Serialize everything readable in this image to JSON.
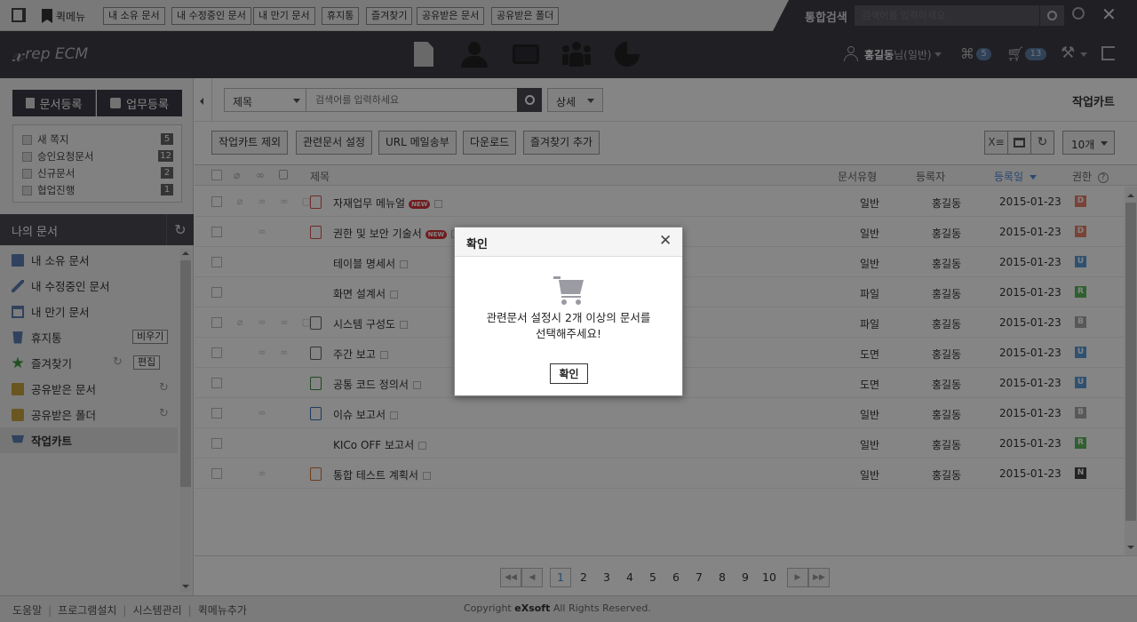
{
  "topbar": {
    "quickmenu_label": "퀵메뉴",
    "quick_links": [
      "내 소유 문서",
      "내 수정중인 문서",
      "내 만기 문서",
      "휴지통",
      "즐겨찾기",
      "공유받은 문서",
      "공유받은 폴더"
    ],
    "search_label": "통합검색",
    "search_placeholder": "검색어를 입력하세요"
  },
  "header": {
    "logo_text": "rep ECM",
    "user_name": "홍길동",
    "user_suffix": "님(일반)",
    "approval_count": "5",
    "cart_count": "13"
  },
  "sidebar": {
    "register_doc": "문서등록",
    "register_task": "업무등록",
    "notices": [
      {
        "label": "새 쪽지",
        "count": "5"
      },
      {
        "label": "승인요청문서",
        "count": "12"
      },
      {
        "label": "신규문서",
        "count": "2"
      },
      {
        "label": "협업진행",
        "count": "1"
      }
    ],
    "mydocs_title": "나의 문서",
    "items": [
      {
        "label": "내 소유 문서",
        "icon": "book-icon"
      },
      {
        "label": "내 수정중인 문서",
        "icon": "pencil-icon"
      },
      {
        "label": "내 만기 문서",
        "icon": "calendar-icon"
      },
      {
        "label": "휴지통",
        "icon": "trash-icon",
        "extra": "비우기"
      },
      {
        "label": "즐겨찾기",
        "icon": "star-icon",
        "extra": "편집"
      },
      {
        "label": "공유받은 문서",
        "icon": "shared-doc-icon"
      },
      {
        "label": "공유받은 폴더",
        "icon": "shared-folder-icon"
      },
      {
        "label": "작업카트",
        "icon": "cart-icon"
      }
    ]
  },
  "main": {
    "search_field_select": "제목",
    "search_placeholder": "검색어를 입력하세요",
    "detail_select": "상세",
    "page_title": "작업카트",
    "toolbar": [
      "작업카트 제외",
      "관련문서 설정",
      "URL 메일송부",
      "다운로드",
      "즐겨찾기 추가"
    ],
    "page_size": "10개",
    "columns": {
      "title": "제목",
      "type": "문서유형",
      "owner": "등록자",
      "date": "등록일",
      "perm": "권한"
    },
    "rows": [
      {
        "title": "자재업무 메뉴얼",
        "new": true,
        "type": "일반",
        "owner": "홍길동",
        "date": "2015-01-23",
        "perm": "D",
        "perm_color": "#e8826a",
        "doc_icon": "pdf",
        "icons": [
          1,
          1,
          1,
          1
        ]
      },
      {
        "title": "권한 및 보안 기술서",
        "new": true,
        "type": "일반",
        "owner": "홍길동",
        "date": "2015-01-23",
        "perm": "D",
        "perm_color": "#e8826a",
        "doc_icon": "pdf",
        "icons": [
          0,
          1,
          0,
          0
        ]
      },
      {
        "title": "테이블 명세서",
        "new": false,
        "type": "일반",
        "owner": "홍길동",
        "date": "2015-01-23",
        "perm": "U",
        "perm_color": "#5a9bd8",
        "doc_icon": "",
        "icons": [
          0,
          0,
          0,
          0
        ]
      },
      {
        "title": "화면 설계서",
        "new": false,
        "type": "파일",
        "owner": "홍길동",
        "date": "2015-01-23",
        "perm": "R",
        "perm_color": "#5cb85c",
        "doc_icon": "",
        "icons": [
          0,
          0,
          0,
          0
        ]
      },
      {
        "title": "시스템 구성도",
        "new": false,
        "type": "파일",
        "owner": "홍길동",
        "date": "2015-01-23",
        "perm": "B",
        "perm_color": "#aaaaaa",
        "doc_icon": "doc",
        "icons": [
          1,
          1,
          1,
          1
        ]
      },
      {
        "title": "주간 보고",
        "new": false,
        "type": "도면",
        "owner": "홍길동",
        "date": "2015-01-23",
        "perm": "U",
        "perm_color": "#5a9bd8",
        "doc_icon": "doc",
        "icons": [
          0,
          1,
          1,
          0
        ]
      },
      {
        "title": "공통 코드 정의서",
        "new": false,
        "type": "도면",
        "owner": "홍길동",
        "date": "2015-01-23",
        "perm": "U",
        "perm_color": "#5a9bd8",
        "doc_icon": "xls",
        "icons": [
          0,
          0,
          0,
          0
        ]
      },
      {
        "title": "이슈 보고서",
        "new": false,
        "type": "일반",
        "owner": "홍길동",
        "date": "2015-01-23",
        "perm": "B",
        "perm_color": "#aaaaaa",
        "doc_icon": "word",
        "icons": [
          0,
          1,
          0,
          0
        ]
      },
      {
        "title": "KICo OFF 보고서",
        "new": false,
        "type": "일반",
        "owner": "홍길동",
        "date": "2015-01-23",
        "perm": "R",
        "perm_color": "#5cb85c",
        "doc_icon": "",
        "icons": [
          0,
          0,
          0,
          0
        ]
      },
      {
        "title": "통합 테스트 계획서",
        "new": false,
        "type": "일반",
        "owner": "홍길동",
        "date": "2015-01-23",
        "perm": "N",
        "perm_color": "#444444",
        "doc_icon": "ppt",
        "icons": [
          0,
          1,
          0,
          0
        ]
      }
    ],
    "pages": [
      "1",
      "2",
      "3",
      "4",
      "5",
      "6",
      "7",
      "8",
      "9",
      "10"
    ]
  },
  "footer": {
    "links": [
      "도움말",
      "프로그램설치",
      "시스템관리",
      "퀵메뉴추가"
    ],
    "copyright_prefix": "Copyright ",
    "copyright_brand": "eXsoft",
    "copyright_suffix": " All Rights Reserved."
  },
  "modal": {
    "title": "확인",
    "message_line1": "관련문서 설정시 2개 이상의 문서를",
    "message_line2": "선택해주세요!",
    "ok_label": "확인"
  }
}
